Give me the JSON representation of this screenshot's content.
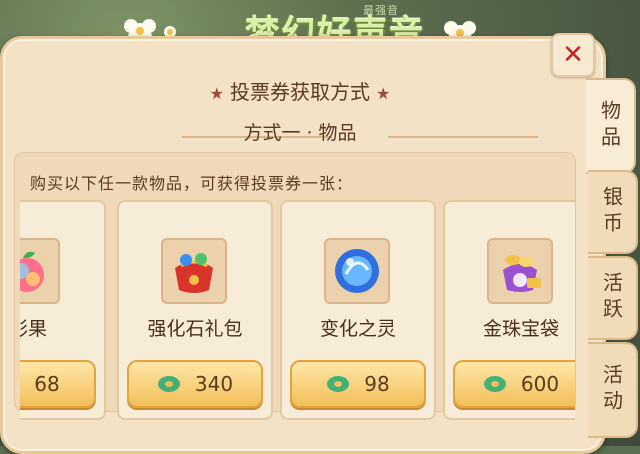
{
  "banner": {
    "title": "梦幻好声音",
    "subtitle": "最强音"
  },
  "dialog": {
    "header": "投票券获取方式",
    "method_title": "方式一 · 物品",
    "description": "购买以下任一款物品，可获得投票券一张：",
    "close_symbol": "✕"
  },
  "items": [
    {
      "name": "彩果",
      "price": "68"
    },
    {
      "name": "强化石礼包",
      "price": "340"
    },
    {
      "name": "变化之灵",
      "price": "98"
    },
    {
      "name": "金珠宝袋",
      "price": "600"
    }
  ],
  "tabs": [
    {
      "label": "物品"
    },
    {
      "label": "银币"
    },
    {
      "label": "活跃"
    },
    {
      "label": "活动"
    }
  ],
  "colors": {
    "panel": "#f3e2c6",
    "price_button": "#f3bf59",
    "close_x": "#c4252a",
    "text": "#5a3b21"
  }
}
